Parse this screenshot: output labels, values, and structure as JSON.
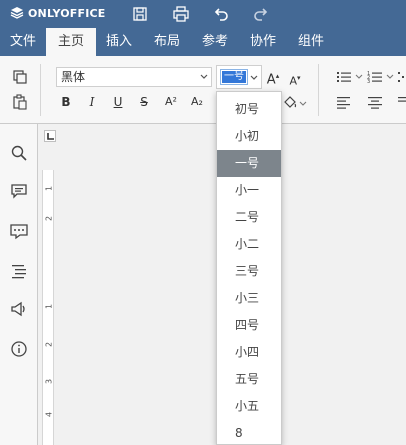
{
  "app": {
    "logo_text": "ONLYOFFICE"
  },
  "menu_tabs": [
    {
      "label": "文件"
    },
    {
      "label": "主页"
    },
    {
      "label": "插入"
    },
    {
      "label": "布局"
    },
    {
      "label": "参考"
    },
    {
      "label": "协作"
    },
    {
      "label": "组件"
    }
  ],
  "active_tab": "主页",
  "toolbar": {
    "font_name": "黑体",
    "font_size": "一号",
    "bold_label": "B",
    "italic_label": "I",
    "underline_label": "U",
    "strike_label": "S",
    "superscript_label": "A²",
    "subscript_label": "A₂",
    "increase_size_label": "A",
    "decrease_size_label": "A"
  },
  "font_size_menu": {
    "items": [
      "初号",
      "小初",
      "一号",
      "小一",
      "二号",
      "小二",
      "三号",
      "小三",
      "四号",
      "小四",
      "五号",
      "小五",
      "8"
    ],
    "selected": "一号"
  },
  "ruler": {
    "labels": [
      "1",
      "2",
      "1",
      "2",
      "3",
      "4"
    ]
  },
  "colors": {
    "header_bg": "#446995",
    "toolbar_bg": "#f7f7f7",
    "selected_item_bg": "#7d858c",
    "size_highlight": "#3377d8"
  },
  "icons": {
    "title_bar": [
      "logo-icon",
      "save-icon",
      "print-icon",
      "undo-icon",
      "redo-icon"
    ],
    "sidebar": [
      "search-icon",
      "comments-icon",
      "chat-icon",
      "navigation-icon",
      "feedback-icon",
      "about-icon"
    ]
  }
}
